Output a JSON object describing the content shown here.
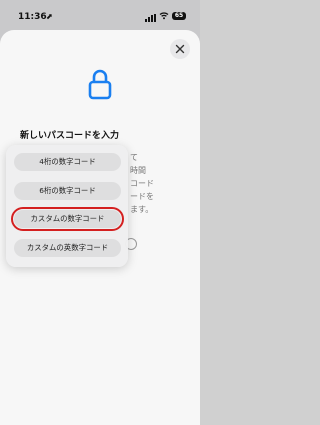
{
  "status": {
    "time": "11:36",
    "location_arrow": "⬈",
    "wifi_icon": "wifi-icon",
    "battery_level": "65"
  },
  "sheet": {
    "close_icon": "close-icon",
    "lock_icon": "lock-icon",
    "title": "新しいパスコードを入力",
    "description_lines": [
      "て",
      "時間",
      "コード",
      "ードを",
      "ます。"
    ]
  },
  "menu": {
    "items": [
      {
        "label": "4桁の数字コード"
      },
      {
        "label": "6桁の数字コード"
      },
      {
        "label": "カスタムの数字コード"
      },
      {
        "label": "カスタムの英数字コード"
      }
    ],
    "highlight_color": "#d42020"
  },
  "colors": {
    "accent": "#1a7ff0",
    "sheet_bg": "#f7f7f7"
  }
}
